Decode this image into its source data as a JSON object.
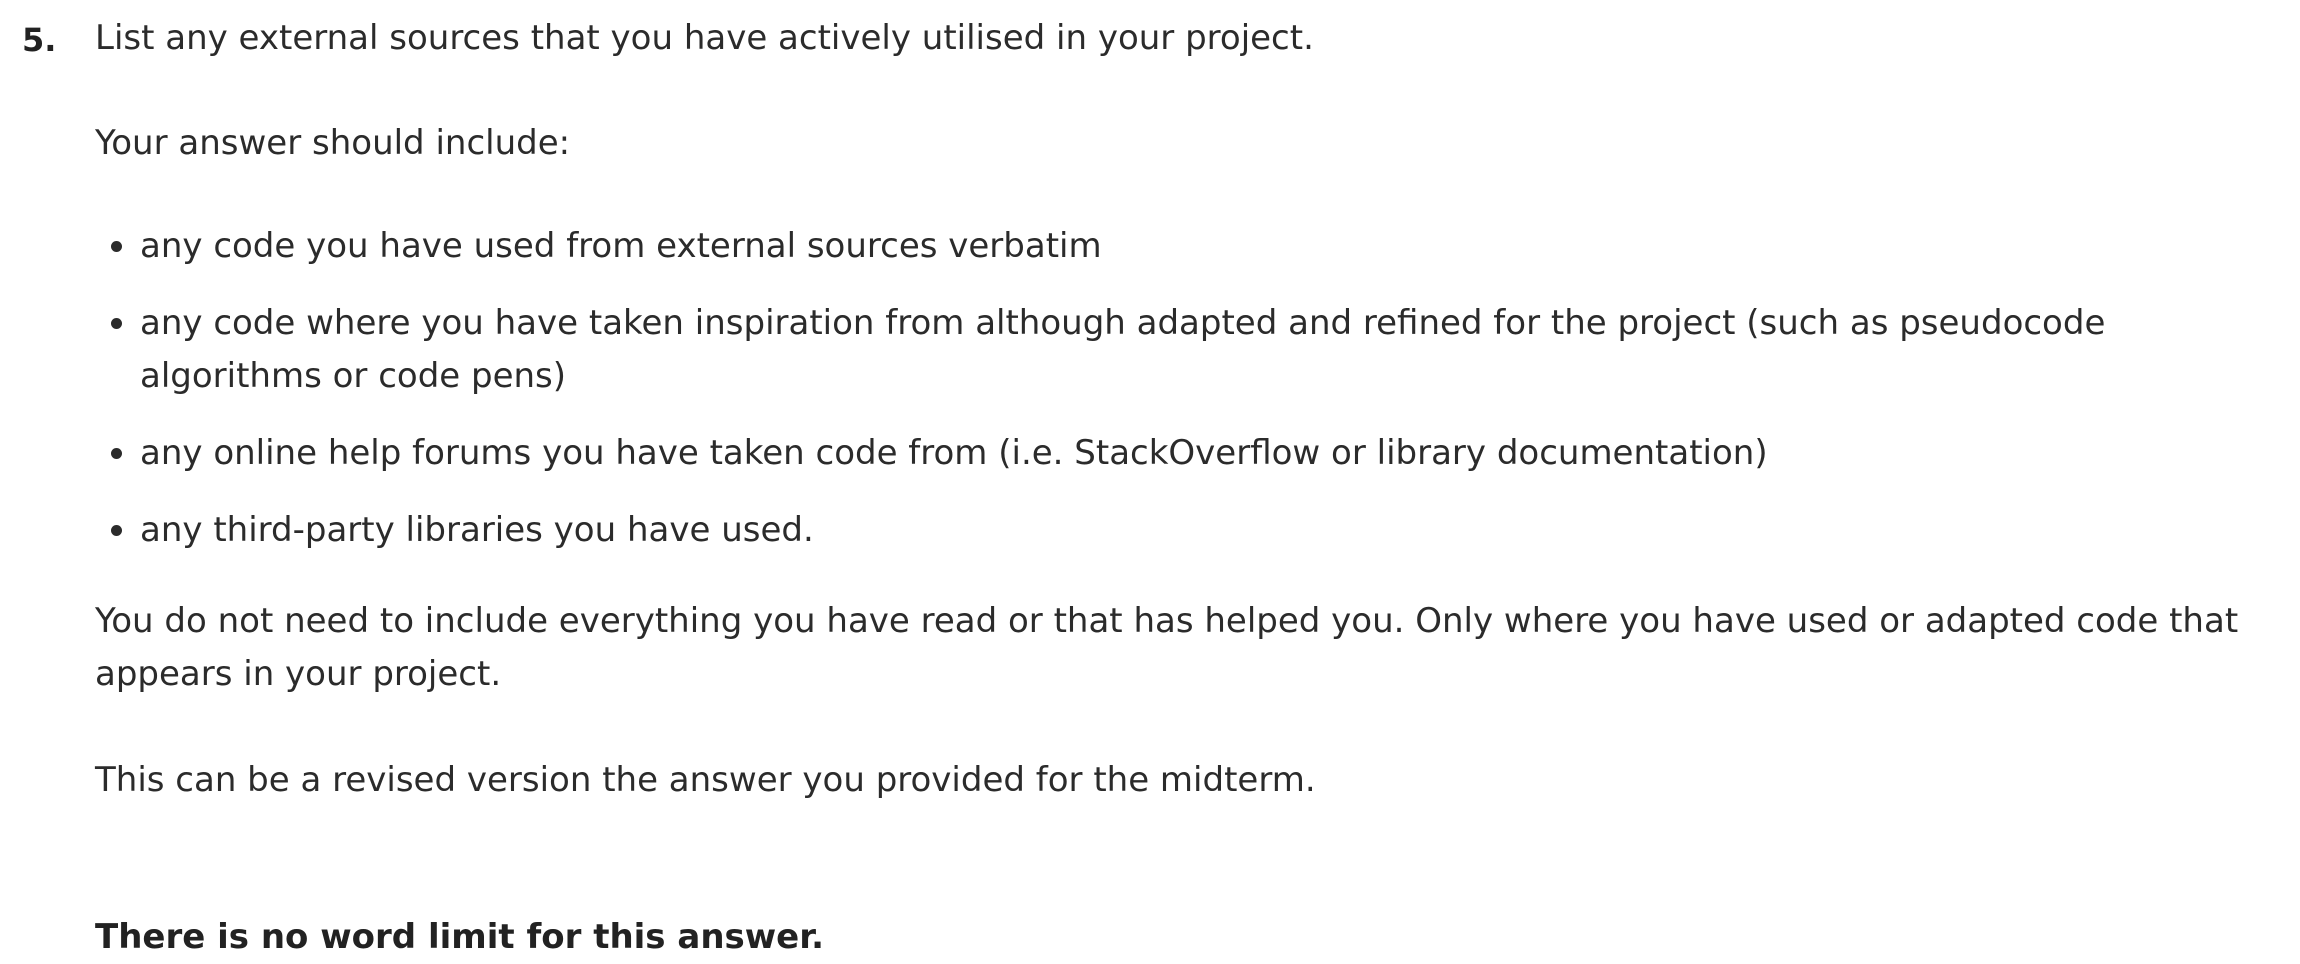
{
  "question": {
    "number": "5.",
    "prompt": "List any external sources that you have actively utilised in your project.",
    "intro": "Your answer should include:",
    "criteria": [
      "any code you have used from external sources verbatim",
      "any code where you have taken inspiration from although adapted and refined for the project (such as pseudocode algorithms or code pens)",
      "any online help forums you have taken code from (i.e. StackOverflow or library documentation)",
      "any third-party libraries you have used."
    ],
    "note": "You do not need to include everything you have read or that has helped you. Only where you have used or adapted code that appears in your project.",
    "revised": "This can be a revised version the answer you provided for the midterm.",
    "word_limit": "There is no word limit for this answer."
  }
}
